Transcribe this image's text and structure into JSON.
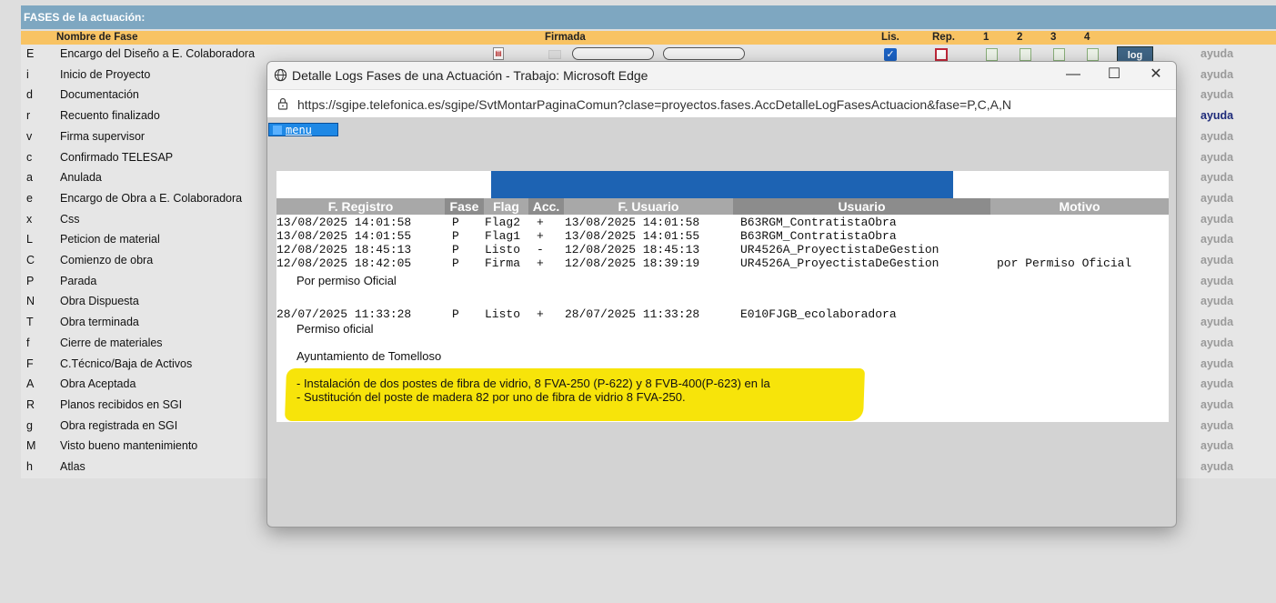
{
  "background": {
    "section_title": "FASES de la actuación:",
    "col_headers": {
      "nombre": "Nombre de Fase",
      "firmada": "Firmada",
      "lis": "Lis.",
      "rep": "Rep.",
      "c1": "1",
      "c2": "2",
      "c3": "3",
      "c4": "4"
    },
    "log_button": "log",
    "rows": [
      {
        "code": "E",
        "name": "Encargo del Diseño a E. Colaboradora",
        "help": "ayuda"
      },
      {
        "code": "i",
        "name": "Inicio de Proyecto",
        "help": "ayuda"
      },
      {
        "code": "d",
        "name": "Documentación",
        "help": "ayuda"
      },
      {
        "code": "r",
        "name": "Recuento finalizado",
        "help": "ayuda"
      },
      {
        "code": "v",
        "name": "Firma supervisor",
        "help": "ayuda"
      },
      {
        "code": "c",
        "name": "Confirmado TELESAP",
        "help": "ayuda"
      },
      {
        "code": "a",
        "name": "Anulada",
        "help": "ayuda"
      },
      {
        "code": "e",
        "name": "Encargo de Obra a E. Colaboradora",
        "help": "ayuda"
      },
      {
        "code": "x",
        "name": "Css",
        "help": "ayuda"
      },
      {
        "code": "L",
        "name": "Peticion de material",
        "help": "ayuda"
      },
      {
        "code": "C",
        "name": "Comienzo de obra",
        "help": "ayuda"
      },
      {
        "code": "P",
        "name": "Parada",
        "help": "ayuda"
      },
      {
        "code": "N",
        "name": "Obra Dispuesta",
        "help": "ayuda"
      },
      {
        "code": "T",
        "name": "Obra terminada",
        "help": "ayuda"
      },
      {
        "code": "f",
        "name": "Cierre de materiales",
        "help": "ayuda"
      },
      {
        "code": "F",
        "name": "C.Técnico/Baja de Activos",
        "help": "ayuda"
      },
      {
        "code": "A",
        "name": "Obra Aceptada",
        "help": "ayuda"
      },
      {
        "code": "R",
        "name": "Planos recibidos en SGI",
        "help": "ayuda"
      },
      {
        "code": "g",
        "name": "Obra registrada en SGI",
        "help": "ayuda"
      },
      {
        "code": "M",
        "name": "Visto bueno mantenimiento",
        "help": "ayuda"
      },
      {
        "code": "h",
        "name": "Atlas",
        "help": "ayuda"
      }
    ]
  },
  "popup": {
    "window_title": "Detalle Logs Fases de una Actuación - Trabajo: Microsoft Edge",
    "url": "https://sgipe.telefonica.es/sgipe/SvtMontarPaginaComun?clase=proyectos.fases.AccDetalleLogFasesActuacion&fase=P,C,A,N",
    "menu_label": "menu",
    "table_headers": {
      "registro": "F. Registro",
      "fase": "Fase",
      "flag": "Flag",
      "acc": "Acc.",
      "fusuario": "F. Usuario",
      "usuario": "Usuario",
      "motivo": "Motivo"
    },
    "log_rows": [
      {
        "registro": "13/08/2025 14:01:58",
        "fase": "P",
        "flag": "Flag2",
        "acc": "+",
        "fusuario": "13/08/2025 14:01:58",
        "usuario": "B63RGM_ContratistaObra",
        "motivo": ""
      },
      {
        "registro": "13/08/2025 14:01:55",
        "fase": "P",
        "flag": "Flag1",
        "acc": "+",
        "fusuario": "13/08/2025 14:01:55",
        "usuario": "B63RGM_ContratistaObra",
        "motivo": ""
      },
      {
        "registro": "12/08/2025 18:45:13",
        "fase": "P",
        "flag": "Listo",
        "acc": "-",
        "fusuario": "12/08/2025 18:45:13",
        "usuario": "UR4526A_ProyectistaDeGestion",
        "motivo": ""
      },
      {
        "registro": "12/08/2025 18:42:05",
        "fase": "P",
        "flag": "Firma",
        "acc": "+",
        "fusuario": "12/08/2025 18:39:19",
        "usuario": "UR4526A_ProyectistaDeGestion",
        "motivo": "por Permiso Oficial"
      },
      {
        "registro": "28/07/2025 11:33:28",
        "fase": "P",
        "flag": "Listo",
        "acc": "+",
        "fusuario": "28/07/2025 11:33:28",
        "usuario": "E010FJGB_ecolaboradora",
        "motivo": ""
      }
    ],
    "note_after_firma": "Por permiso Oficial",
    "note_permiso": "Permiso oficial",
    "note_ayuntamiento": "Ayuntamiento de Tomelloso",
    "highlight_line1": "- Instalación de dos postes de fibra de vidrio, 8 FVA-250 (P-622) y 8 FVB-400(P-623) en la",
    "highlight_line2": "- Sustitución del poste de madera 82 por uno de fibra de vidrio 8 FVA-250.",
    "highlight_color": "#f7e40a",
    "accent_blue": "#1d63b3"
  }
}
